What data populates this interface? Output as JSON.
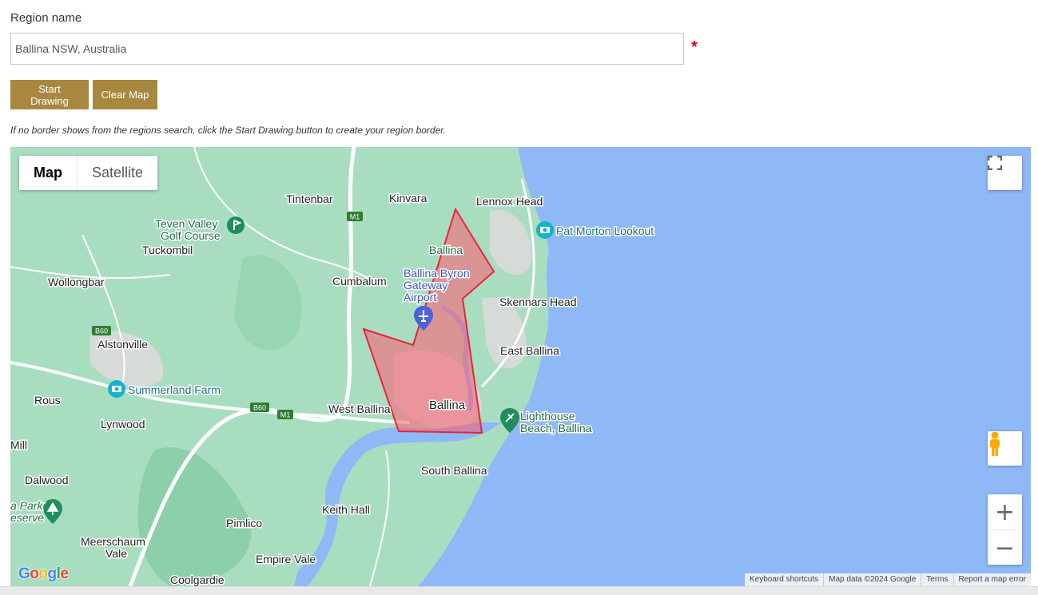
{
  "form": {
    "region_label": "Region name",
    "region_value": "Ballina NSW, Australia",
    "required_mark": "*",
    "start_drawing_label": "Start Drawing",
    "clear_map_label": "Clear Map",
    "hint": "If no border shows from the regions search, click the Start Drawing button to create your region border."
  },
  "map": {
    "type_controls": {
      "map_label": "Map",
      "satellite_label": "Satellite",
      "selected": "Map"
    },
    "zoom_in": "+",
    "zoom_out": "−",
    "logo": "Google",
    "attribution": {
      "keyboard_shortcuts": "Keyboard shortcuts",
      "map_data": "Map data ©2024 Google",
      "terms": "Terms",
      "report": "Report a map error"
    },
    "places": {
      "tintenbar": "Tintenbar",
      "kinvara": "Kinvara",
      "lennox_head": "Lennox Head",
      "pat_morton": "Pat Morton Lookout",
      "teven_valley_1": "Teven Valley",
      "teven_valley_2": "Golf Course",
      "tuckombil": "Tuckombil",
      "ballina_north": "Ballina",
      "airport_1": "Ballina Byron",
      "airport_2": "Gateway",
      "airport_3": "Airport",
      "wollongbar": "Wollongbar",
      "cumbalum": "Cumbalum",
      "skennars_head": "Skennars Head",
      "alstonville": "Alstonville",
      "east_ballina": "East Ballina",
      "summerland": "Summerland Farm",
      "rous": "Rous",
      "lynwood": "Lynwood",
      "west_ballina": "West Ballina",
      "ballina_main": "Ballina",
      "lighthouse_1": "Lighthouse",
      "lighthouse_2": "Beach, Ballina",
      "mill": "Mill",
      "dalwood": "Dalwood",
      "south_ballina": "South Ballina",
      "park_1": "a Park",
      "park_2": "eserve",
      "keith_hall": "Keith Hall",
      "pimlico": "Pimlico",
      "meerschaum_1": "Meerschaum",
      "meerschaum_2": "Vale",
      "empire_vale": "Empire Vale",
      "coolgardie": "Coolgardie"
    },
    "road_shields": {
      "m1_north": "M1",
      "b60_west": "B60",
      "b60_south": "B60",
      "m1_south": "M1"
    },
    "colors": {
      "ocean": "#8fb8f7",
      "land": "#a9ddc0",
      "urban": "#d6dbd7",
      "road": "#ffffff",
      "polygon_fill": "#ff5a6e",
      "polygon_stroke": "#e8253b",
      "button": "#a8873f"
    },
    "icons": [
      "camera-poi-icon",
      "golf-poi-icon",
      "airport-pin-icon",
      "beach-poi-icon",
      "park-tree-icon",
      "fullscreen-icon",
      "pegman-icon"
    ]
  }
}
